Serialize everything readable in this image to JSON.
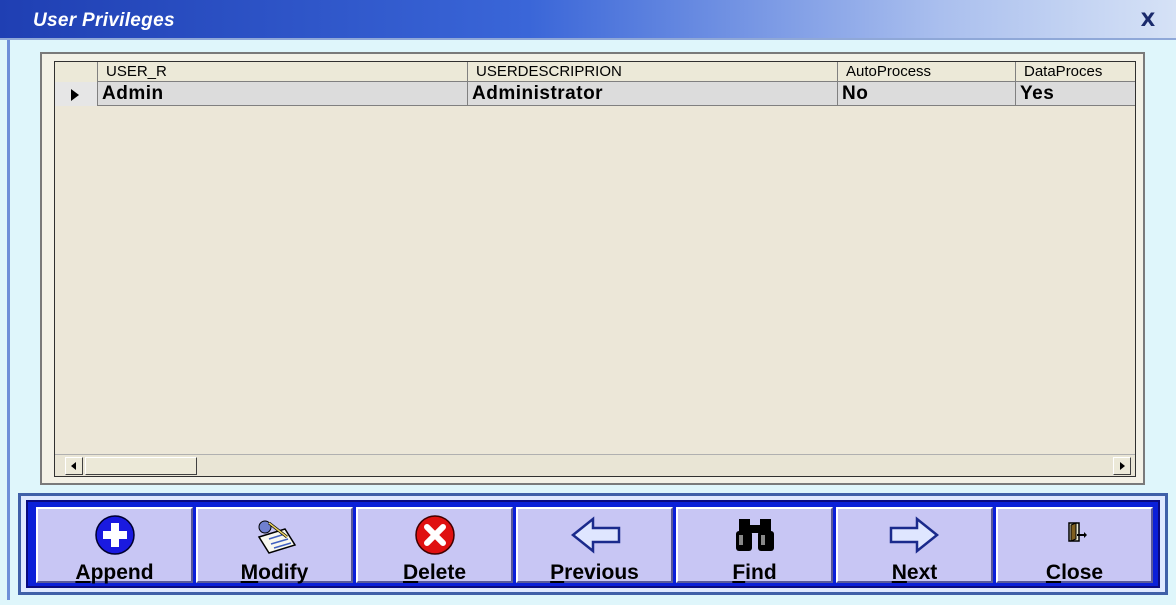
{
  "window": {
    "title": "User Privileges",
    "close_label": "X"
  },
  "grid": {
    "columns": [
      "USER_R",
      "USERDESCRIPRION",
      "AutoProcess",
      "DataProces"
    ],
    "rows": [
      {
        "cells": [
          "Admin",
          "Administrator",
          "No",
          "Yes"
        ],
        "selected": true
      }
    ]
  },
  "toolbar": {
    "buttons": [
      {
        "label": "Append",
        "icon": "plus-circle-icon"
      },
      {
        "label": "Modify",
        "icon": "edit-notepad-icon"
      },
      {
        "label": "Delete",
        "icon": "delete-x-icon"
      },
      {
        "label": "Previous",
        "icon": "arrow-left-icon"
      },
      {
        "label": "Find",
        "icon": "binoculars-icon"
      },
      {
        "label": "Next",
        "icon": "arrow-right-icon"
      },
      {
        "label": "Close",
        "icon": "exit-door-icon"
      }
    ]
  },
  "colors": {
    "title_bar": "#1f3fb3",
    "toolbar_bg": "#0b1fd8",
    "button_bg": "#c8c6f4",
    "grid_bg": "#ece7d8"
  }
}
